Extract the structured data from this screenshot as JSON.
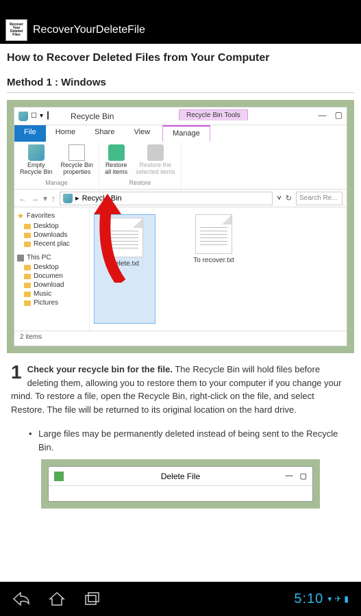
{
  "app": {
    "icon_text": "Recover Your Deleted Files",
    "title": "RecoverYourDeleteFile"
  },
  "article": {
    "title": "How to Recover Deleted Files from Your Computer",
    "method_label": "Method 1 : Windows"
  },
  "win": {
    "title": "Recycle Bin",
    "tools_tab": "Recycle Bin Tools",
    "tabs": {
      "file": "File",
      "home": "Home",
      "share": "Share",
      "view": "View",
      "manage": "Manage"
    },
    "ribbon": {
      "empty": "Empty\nRecycle Bin",
      "props": "Recycle Bin\nproperties",
      "restore_all": "Restore\nall items",
      "restore_sel": "Restore the\nselected items",
      "group_manage": "Manage",
      "group_restore": "Restore"
    },
    "address": "Recycle Bin",
    "search_placeholder": "Search Re...",
    "sidebar": {
      "favorites": "Favorites",
      "fav_items": [
        "Desktop",
        "Downloads",
        "Recent plac"
      ],
      "thispc": "This PC",
      "pc_items": [
        "Desktop",
        "Documen",
        "Download",
        "Music",
        "Pictures"
      ]
    },
    "files": [
      "Delete.txt",
      "To recover.txt"
    ],
    "status": "2 items"
  },
  "step": {
    "num": "1",
    "bold": "Check your recycle bin for the file.",
    "text": " The Recycle Bin will hold files before deleting them, allowing you to restore them to your computer if you change your mind. To restore a file, open the Recycle Bin, right-click on the file, and select Restore. The file will be returned to its original location on the hard drive.",
    "bullet": "Large files may be permanently deleted instead of being sent to the Recycle Bin."
  },
  "win2": {
    "title": "Delete File"
  },
  "navbar": {
    "time": "5:10"
  }
}
